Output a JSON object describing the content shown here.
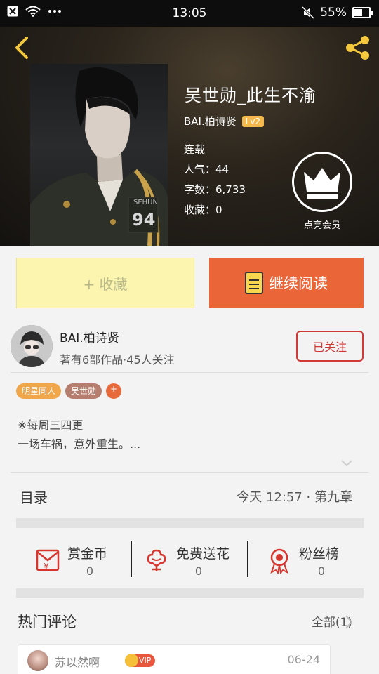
{
  "status_bar": {
    "time": "13:05",
    "battery": "55%",
    "battery_level": 0.55
  },
  "header": {
    "title": "吴世勋_此生不渝",
    "author": "BAI.柏诗贤",
    "level": "Lv2",
    "status": "连载",
    "popularity": "人气：44",
    "word_count": "字数：6,733",
    "favorites": "收藏：0",
    "vip_label": "点亮会员",
    "cover_text": {
      "name": "SEHUN",
      "number": "94"
    }
  },
  "actions": {
    "collect": "+ 收藏",
    "continue_read": "继续阅读"
  },
  "author_card": {
    "name": "BAI.柏诗贤",
    "info": "著有6部作品·45人关注",
    "follow": "已关注"
  },
  "tags": [
    {
      "label": "明星同人",
      "color": "#f0a64a"
    },
    {
      "label": "吴世勋",
      "color": "#b67e6e"
    },
    {
      "label": "+",
      "color": "#e86a3a"
    }
  ],
  "description": {
    "line1": "※每周三四更",
    "line2": "一场车祸，意外重生。..."
  },
  "toc": {
    "label": "目录",
    "latest": "今天 12:57 · 第九章"
  },
  "stats": [
    {
      "label": "赏金币",
      "value": "0"
    },
    {
      "label": "免费送花",
      "value": "0"
    },
    {
      "label": "粉丝榜",
      "value": "0"
    }
  ],
  "comments": {
    "label": "热门评论",
    "all": "全部(1)",
    "items": [
      {
        "user": "苏以然啊",
        "badge": "VIP",
        "date": "06-24"
      }
    ]
  },
  "colors": {
    "accent_orange": "#ea6638",
    "follow_red": "#d03a36",
    "level_badge": "#f2b84b"
  }
}
